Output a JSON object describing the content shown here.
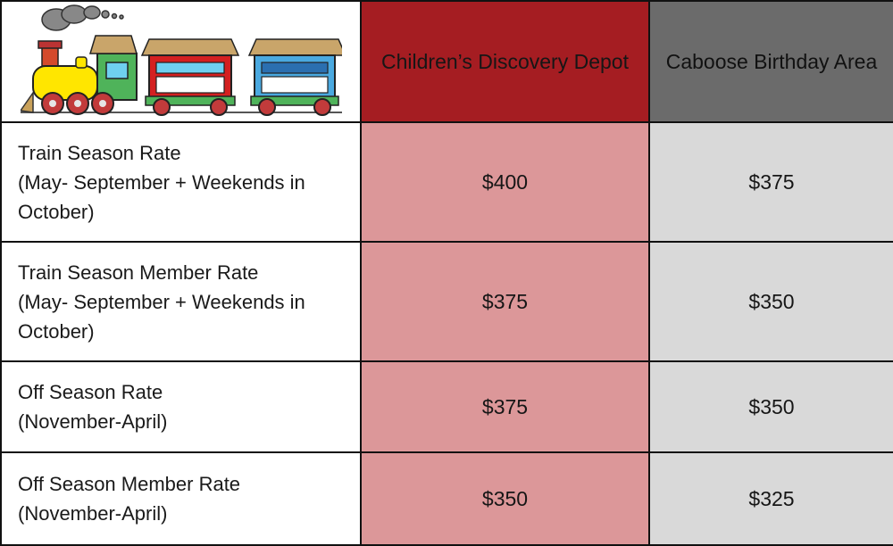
{
  "header": {
    "logo_icon": "toy-train-icon",
    "col2": "Children’s Discovery Depot",
    "col3": "Caboose Birthday Area"
  },
  "colors": {
    "red_header": "#a51d22",
    "red_cell": "#dc9799",
    "gray_header": "#6b6b6b",
    "gray_cell": "#d9d9d9"
  },
  "rows": [
    {
      "label_line1": "Train Season Rate",
      "label_line2": "(May- September + Weekends in October)",
      "discovery_depot": "$400",
      "caboose": "$375"
    },
    {
      "label_line1": "Train Season Member Rate",
      "label_line2": "(May- September + Weekends in October)",
      "discovery_depot": "$375",
      "caboose": "$350"
    },
    {
      "label_line1": "Off Season Rate",
      "label_line2": "(November-April)",
      "discovery_depot": "$375",
      "caboose": "$350"
    },
    {
      "label_line1": "Off Season Member Rate",
      "label_line2": "(November-April)",
      "discovery_depot": "$350",
      "caboose": "$325"
    }
  ]
}
